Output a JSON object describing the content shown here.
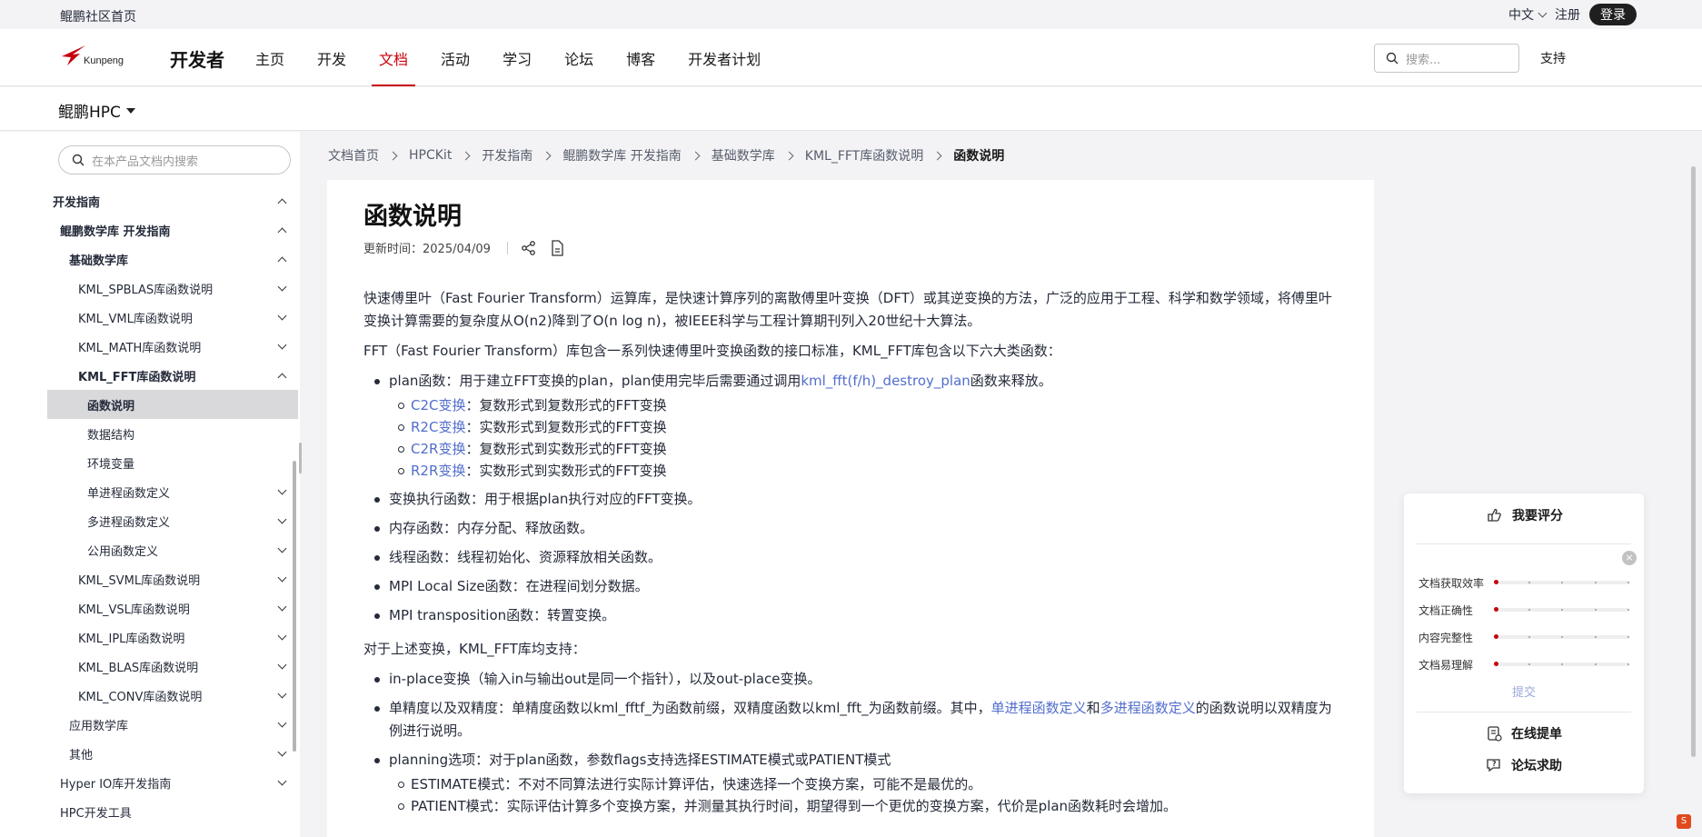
{
  "topbar": {
    "home_link": "鲲鹏社区首页",
    "language": "中文",
    "register": "注册",
    "login": "登录"
  },
  "nav": {
    "logo_text": "Kunpeng",
    "brand": "开发者",
    "items": [
      {
        "label": "主页",
        "active": false
      },
      {
        "label": "开发",
        "active": false
      },
      {
        "label": "文档",
        "active": true
      },
      {
        "label": "活动",
        "active": false
      },
      {
        "label": "学习",
        "active": false
      },
      {
        "label": "论坛",
        "active": false
      },
      {
        "label": "博客",
        "active": false
      },
      {
        "label": "开发者计划",
        "active": false
      }
    ],
    "search_placeholder": "搜索...",
    "support": "支持"
  },
  "product": {
    "name": "鲲鹏HPC"
  },
  "sidebar": {
    "search_placeholder": "在本产品文档内搜索",
    "items": [
      {
        "label": "开发指南",
        "level": 0,
        "bold": true,
        "expand": "up"
      },
      {
        "label": "鲲鹏数学库 开发指南",
        "level": 1,
        "bold": true,
        "expand": "up"
      },
      {
        "label": "基础数学库",
        "level": 2,
        "bold": true,
        "expand": "up"
      },
      {
        "label": "KML_SPBLAS库函数说明",
        "level": 3,
        "bold": false,
        "expand": "down"
      },
      {
        "label": "KML_VML库函数说明",
        "level": 3,
        "bold": false,
        "expand": "down"
      },
      {
        "label": "KML_MATH库函数说明",
        "level": 3,
        "bold": false,
        "expand": "down"
      },
      {
        "label": "KML_FFT库函数说明",
        "level": 3,
        "bold": true,
        "expand": "up"
      },
      {
        "label": "函数说明",
        "level": 4,
        "bold": true,
        "expand": "",
        "selected": true
      },
      {
        "label": "数据结构",
        "level": 4,
        "bold": false,
        "expand": ""
      },
      {
        "label": "环境变量",
        "level": 4,
        "bold": false,
        "expand": ""
      },
      {
        "label": "单进程函数定义",
        "level": 4,
        "bold": false,
        "expand": "down"
      },
      {
        "label": "多进程函数定义",
        "level": 4,
        "bold": false,
        "expand": "down"
      },
      {
        "label": "公用函数定义",
        "level": 4,
        "bold": false,
        "expand": "down"
      },
      {
        "label": "KML_SVML库函数说明",
        "level": 3,
        "bold": false,
        "expand": "down"
      },
      {
        "label": "KML_VSL库函数说明",
        "level": 3,
        "bold": false,
        "expand": "down"
      },
      {
        "label": "KML_IPL库函数说明",
        "level": 3,
        "bold": false,
        "expand": "down"
      },
      {
        "label": "KML_BLAS库函数说明",
        "level": 3,
        "bold": false,
        "expand": "down"
      },
      {
        "label": "KML_CONV库函数说明",
        "level": 3,
        "bold": false,
        "expand": "down"
      },
      {
        "label": "应用数学库",
        "level": 2,
        "bold": false,
        "expand": "down"
      },
      {
        "label": "其他",
        "level": 2,
        "bold": false,
        "expand": "down"
      },
      {
        "label": "Hyper IO库开发指南",
        "level": 1,
        "bold": false,
        "expand": "down"
      },
      {
        "label": "HPC开发工具",
        "level": 1,
        "bold": false,
        "expand": ""
      }
    ]
  },
  "breadcrumb": [
    "文档首页",
    "HPCKit",
    "开发指南",
    "鲲鹏数学库 开发指南",
    "基础数学库",
    "KML_FFT库函数说明",
    "函数说明"
  ],
  "article": {
    "title": "函数说明",
    "updated_label": "更新时间：",
    "updated_date": "2025/04/09",
    "para1": "快速傅里叶（Fast Fourier Transform）运算库，是快速计算序列的离散傅里叶变换（DFT）或其逆变换的方法，广泛的应用于工程、科学和数学领域，将傅里叶变换计算需要的复杂度从O(n2)降到了O(n log n)，被IEEE科学与工程计算期刊列入20世纪十大算法。",
    "para2": "FFT（Fast Fourier Transform）库包含一系列快速傅里叶变换函数的接口标准，KML_FFT库包含以下六大类函数：",
    "plan_prefix": "plan函数：用于建立FFT变换的plan，plan使用完毕后需要通过调用",
    "plan_link": "kml_fft(f/h)_destroy_plan",
    "plan_suffix": "函数来释放。",
    "plan_sub": [
      {
        "link": "C2C变换",
        "text": "：复数形式到复数形式的FFT变换"
      },
      {
        "link": "R2C变换",
        "text": "：实数形式到复数形式的FFT变换"
      },
      {
        "link": "C2R变换",
        "text": "：复数形式到实数形式的FFT变换"
      },
      {
        "link": "R2R变换",
        "text": "：实数形式到实数形式的FFT变换"
      }
    ],
    "bullets": [
      "变换执行函数：用于根据plan执行对应的FFT变换。",
      "内存函数：内存分配、释放函数。",
      "线程函数：线程初始化、资源释放相关函数。",
      "MPI Local Size函数：在进程间划分数据。",
      "MPI transposition函数：转置变换。"
    ],
    "para3": "对于上述变换，KML_FFT库均支持：",
    "support1": "in-place变换（输入in与输出out是同一个指针），以及out-place变换。",
    "support2_prefix": "单精度以及双精度：单精度函数以kml_fftf_为函数前缀，双精度函数以kml_fft_为函数前缀。其中，",
    "support2_link1": "单进程函数定义",
    "support2_mid": "和",
    "support2_link2": "多进程函数定义",
    "support2_suffix": "的函数说明以双精度为例进行说明。",
    "support3": "planning选项：对于plan函数，参数flags支持选择ESTIMATE模式或PATIENT模式",
    "support3_sub": [
      "ESTIMATE模式：不对不同算法进行实际计算评估，快速选择一个变换方案，可能不是最优的。",
      "PATIENT模式：实际评估计算多个变换方案，并测量其执行时间，期望得到一个更优的变换方案，代价是plan函数耗时会增加。"
    ]
  },
  "rating": {
    "title": "我要评分",
    "rows": [
      "文档获取效率",
      "文档正确性",
      "内容完整性",
      "文档易理解"
    ],
    "submit": "提交",
    "action1": "在线提单",
    "action2": "论坛求助"
  },
  "colors": {
    "accent": "#c7000b",
    "link": "#526ecc"
  }
}
